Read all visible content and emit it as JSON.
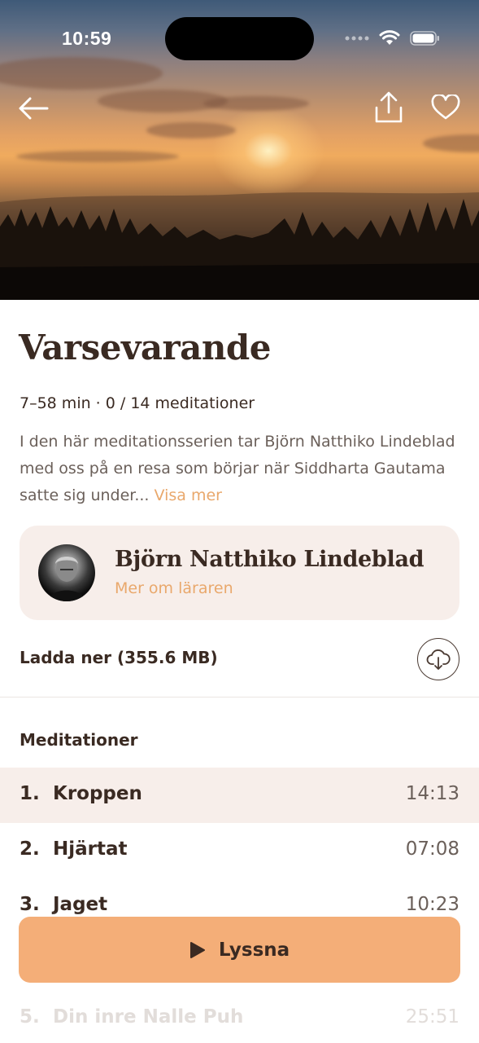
{
  "status_bar": {
    "time": "10:59"
  },
  "hero": {
    "image": "sunset-over-forest",
    "accent": "#f0ab5e"
  },
  "series": {
    "title": "Varsevarande",
    "meta": "7–58 min · 0 / 14 meditationer",
    "description": "I den här meditationsserien tar Björn Natthiko Lindeblad med oss på en resa som börjar när Siddharta Gautama satte sig under...",
    "more_label": "Visa mer"
  },
  "teacher": {
    "name": "Björn Natthiko Lindeblad",
    "link_label": "Mer om läraren"
  },
  "download": {
    "label": "Ladda ner (355.6 MB)"
  },
  "section_title": "Meditationer",
  "tracks": [
    {
      "num": "1.",
      "title": "Kroppen",
      "duration": "14:13",
      "active": true
    },
    {
      "num": "2.",
      "title": "Hjärtat",
      "duration": "07:08"
    },
    {
      "num": "3.",
      "title": "Jaget",
      "duration": "10:23"
    },
    {
      "num": "5.",
      "title": "Din inre Nalle Puh",
      "duration": "25:51"
    }
  ],
  "play_button": {
    "label": "Lyssna"
  },
  "colors": {
    "accent": "#f4ae78",
    "link": "#e9a86c",
    "card": "#f7eeea",
    "text": "#3a2a22"
  }
}
